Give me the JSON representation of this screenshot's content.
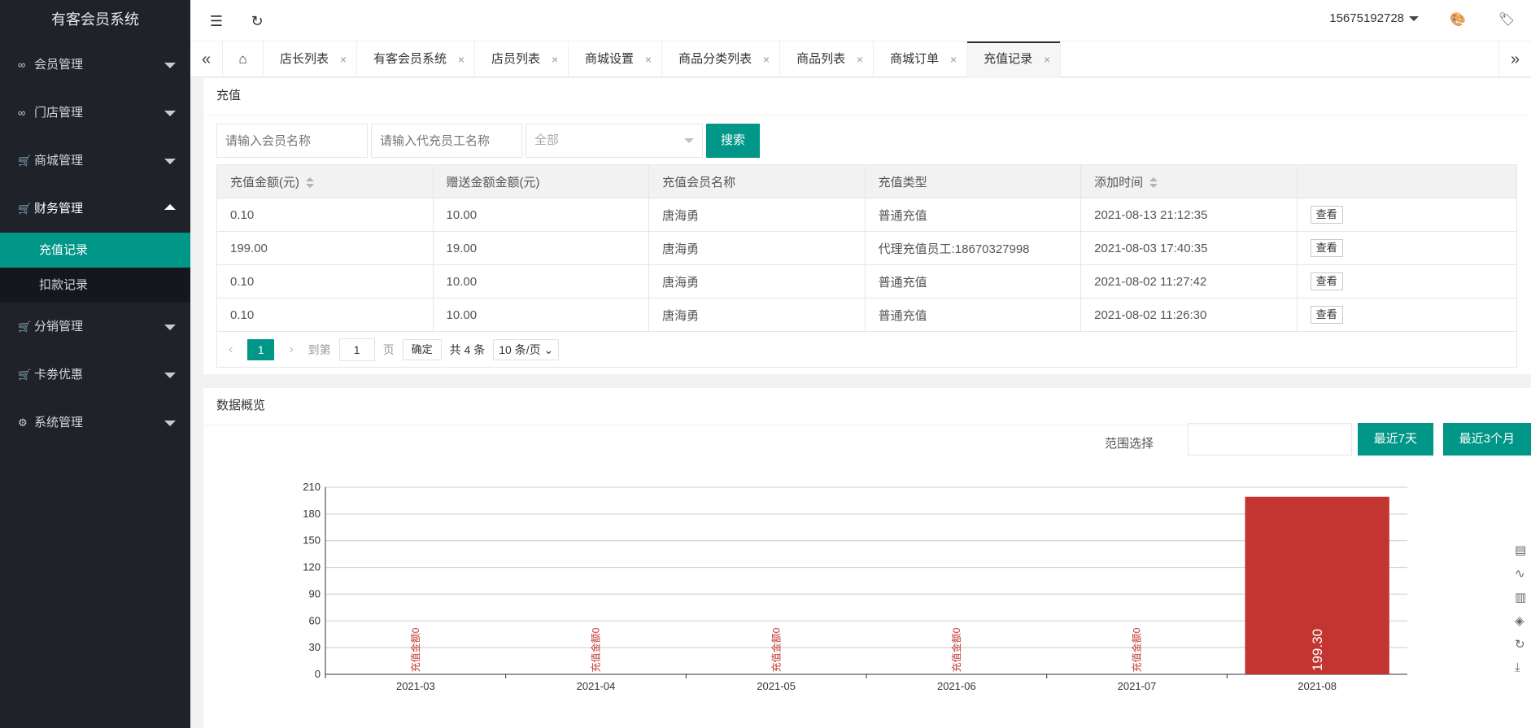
{
  "app": {
    "title": "有客会员系统"
  },
  "sidebar": {
    "items": [
      {
        "label": "会员管理",
        "icon": "link-icon",
        "glyph": "∞"
      },
      {
        "label": "门店管理",
        "icon": "link-icon",
        "glyph": "∞"
      },
      {
        "label": "商城管理",
        "icon": "cart-icon",
        "glyph": "🛒"
      },
      {
        "label": "财务管理",
        "icon": "cart-icon",
        "glyph": "🛒",
        "open": true,
        "children": [
          {
            "label": "充值记录",
            "active": true
          },
          {
            "label": "扣款记录"
          }
        ]
      },
      {
        "label": "分销管理",
        "icon": "cart-icon",
        "glyph": "🛒"
      },
      {
        "label": "卡劵优惠",
        "icon": "cart-icon",
        "glyph": "🛒"
      },
      {
        "label": "系统管理",
        "icon": "gear-icon",
        "glyph": "⚙"
      }
    ]
  },
  "header": {
    "user": "15675192728"
  },
  "tabs": [
    {
      "label": "店长列表"
    },
    {
      "label": "有客会员系统"
    },
    {
      "label": "店员列表"
    },
    {
      "label": "商城设置"
    },
    {
      "label": "商品分类列表"
    },
    {
      "label": "商品列表"
    },
    {
      "label": "商城订单"
    },
    {
      "label": "充值记录",
      "active": true
    }
  ],
  "recharge": {
    "title": "充值",
    "filters": {
      "member_placeholder": "请输入会员名称",
      "staff_placeholder": "请输入代充员工名称",
      "type_value": "全部",
      "search_label": "搜索"
    },
    "columns": [
      "充值金额(元)",
      "赠送金额金额(元)",
      "充值会员名称",
      "充值类型",
      "添加时间",
      ""
    ],
    "rows": [
      [
        "0.10",
        "10.00",
        "唐海勇",
        "普通充值",
        "2021-08-13 21:12:35",
        "查看"
      ],
      [
        "199.00",
        "19.00",
        "唐海勇",
        "代理充值员工:18670327998",
        "2021-08-03 17:40:35",
        "查看"
      ],
      [
        "0.10",
        "10.00",
        "唐海勇",
        "普通充值",
        "2021-08-02 11:27:42",
        "查看"
      ],
      [
        "0.10",
        "10.00",
        "唐海勇",
        "普通充值",
        "2021-08-02 11:26:30",
        "查看"
      ]
    ],
    "pager": {
      "current": "1",
      "goto_label": "到第",
      "goto_value": "1",
      "page_unit": "页",
      "confirm": "确定",
      "total": "共 4 条",
      "page_size": "10 条/页"
    }
  },
  "overview": {
    "title": "数据概览",
    "range_label": "范围选择",
    "btn_7days": "最近7天",
    "btn_3months": "最近3个月"
  },
  "chart_data": {
    "type": "bar",
    "categories": [
      "2021-03",
      "2021-04",
      "2021-05",
      "2021-06",
      "2021-07",
      "2021-08"
    ],
    "values": [
      0,
      0,
      0,
      0,
      0,
      199.3
    ],
    "data_labels": [
      "充值金额0",
      "充值金额0",
      "充值金额0",
      "充值金额0",
      "充值金额0",
      "199.30"
    ],
    "ylim": [
      0,
      210
    ],
    "yticks": [
      0,
      30,
      60,
      90,
      120,
      150,
      180,
      210
    ],
    "grid": true,
    "color": "#c23531"
  }
}
